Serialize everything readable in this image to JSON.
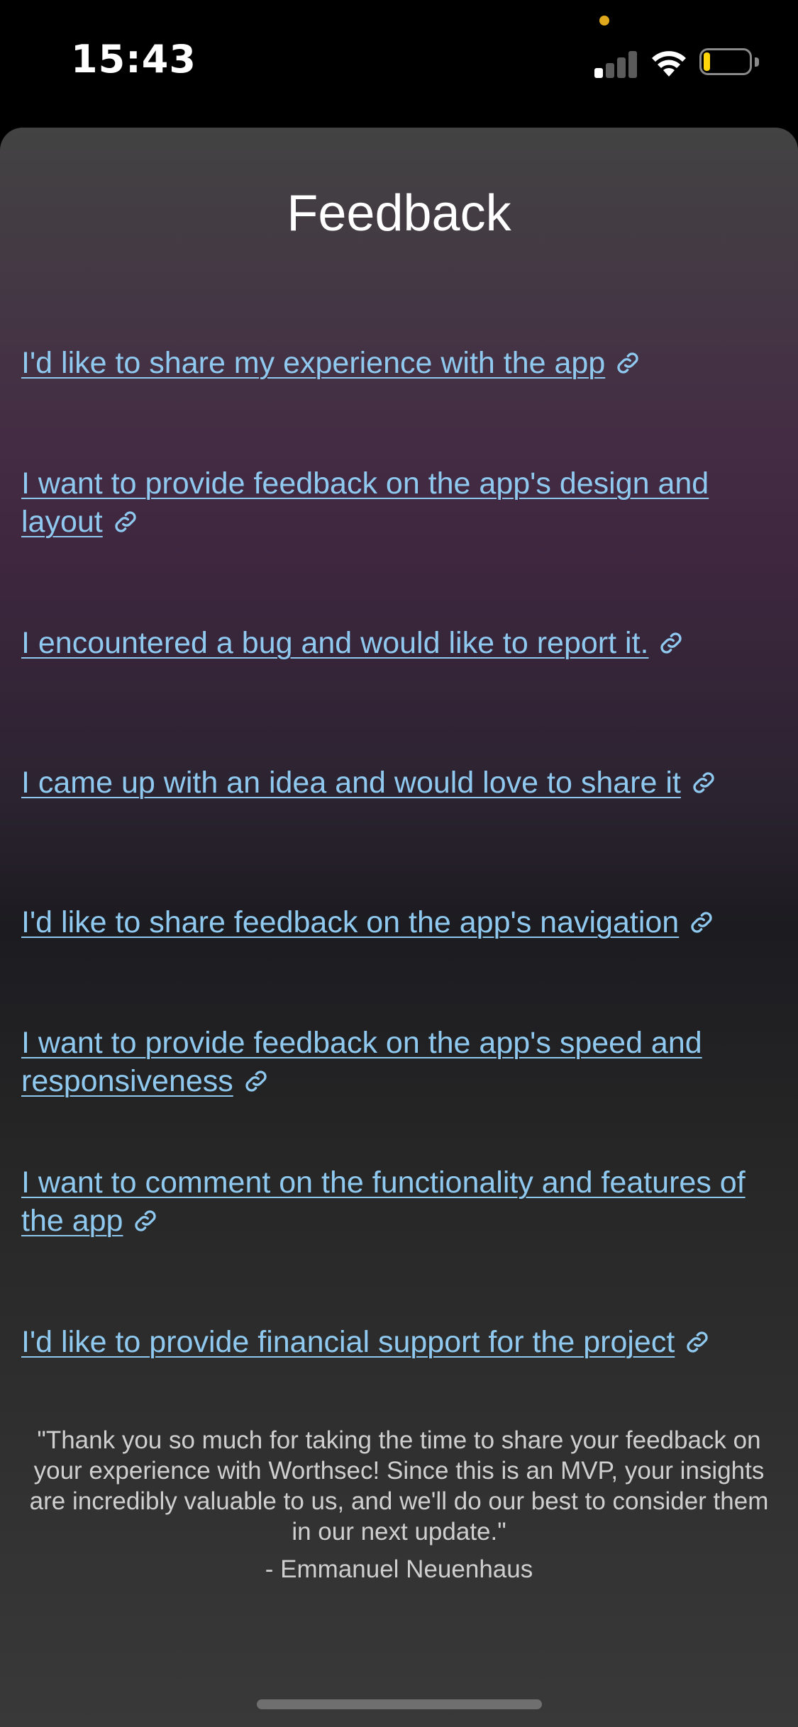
{
  "status_bar": {
    "time": "15:43",
    "signal_bars_active": 1,
    "battery_level": 0.15,
    "battery_color": "#ffd60a",
    "privacy_dot_color": "#e0a81c"
  },
  "sheet": {
    "title": "Feedback",
    "link_color": "#8fc9ef",
    "link_icon": "link-icon",
    "links": [
      {
        "label": "I'd like to share my experience with the app"
      },
      {
        "label": "I want to provide feedback on the app's design and layout"
      },
      {
        "label": "I encountered a bug and would like to report it."
      },
      {
        "label": "I came up with an idea and would love to share it"
      },
      {
        "label": "I'd like to share feedback on the app's navigation"
      },
      {
        "label": "I want to provide feedback on the app's speed and responsiveness"
      },
      {
        "label": "I want to comment on the functionality and features of the app"
      },
      {
        "label": "I'd like to provide financial support for the project"
      }
    ],
    "thanks_text": "\"Thank you so much for taking the time to share your feedback on your experience with Worthsec! Since this is an MVP, your insights are incredibly valuable to us, and we'll do our best to consider them in our next update.\"",
    "signature": "- Emmanuel Neuenhaus"
  }
}
